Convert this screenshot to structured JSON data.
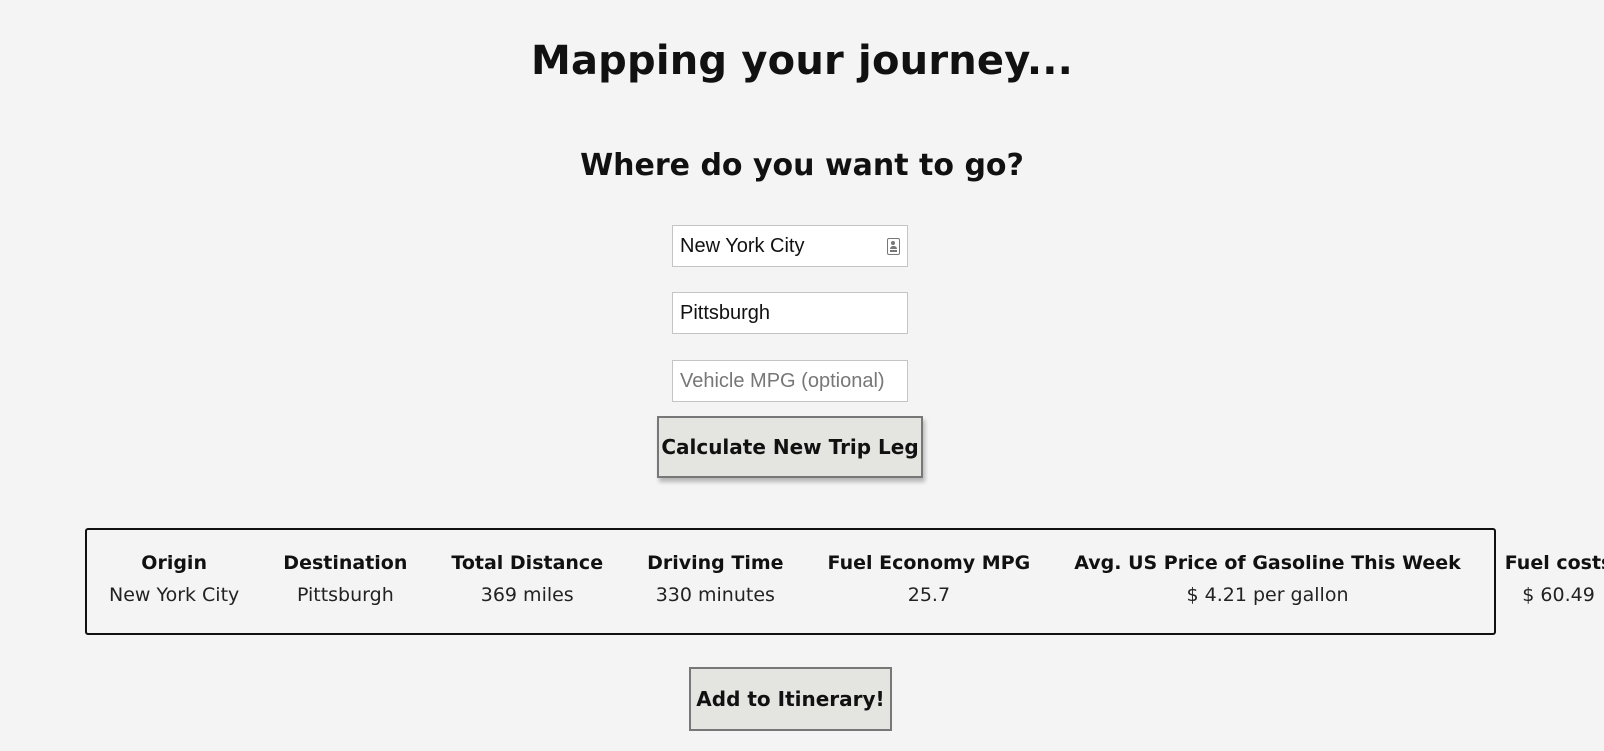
{
  "page": {
    "title": "Mapping your journey...",
    "subtitle": "Where do you want to go?"
  },
  "form": {
    "origin": {
      "value": "New York City",
      "placeholder": ""
    },
    "destination": {
      "value": "Pittsburgh",
      "placeholder": ""
    },
    "mpg": {
      "value": "",
      "placeholder": "Vehicle MPG (optional)"
    },
    "calculate_label": "Calculate New Trip Leg"
  },
  "results": {
    "headers": [
      "Origin",
      "Destination",
      "Total Distance",
      "Driving Time",
      "Fuel Economy MPG",
      "Avg. US Price of Gasoline This Week",
      "Fuel costs"
    ],
    "row": [
      "New York City",
      "Pittsburgh",
      "369 miles",
      "330 minutes",
      "25.7",
      "$ 4.21 per gallon",
      "$ 60.49"
    ]
  },
  "actions": {
    "add_label": "Add to Itinerary!"
  },
  "icons": {
    "origin_field_icon": "contact-card-icon"
  },
  "colors": {
    "background": "#f4f4f4",
    "button_bg": "#e4e4e1",
    "border": "#111111"
  }
}
